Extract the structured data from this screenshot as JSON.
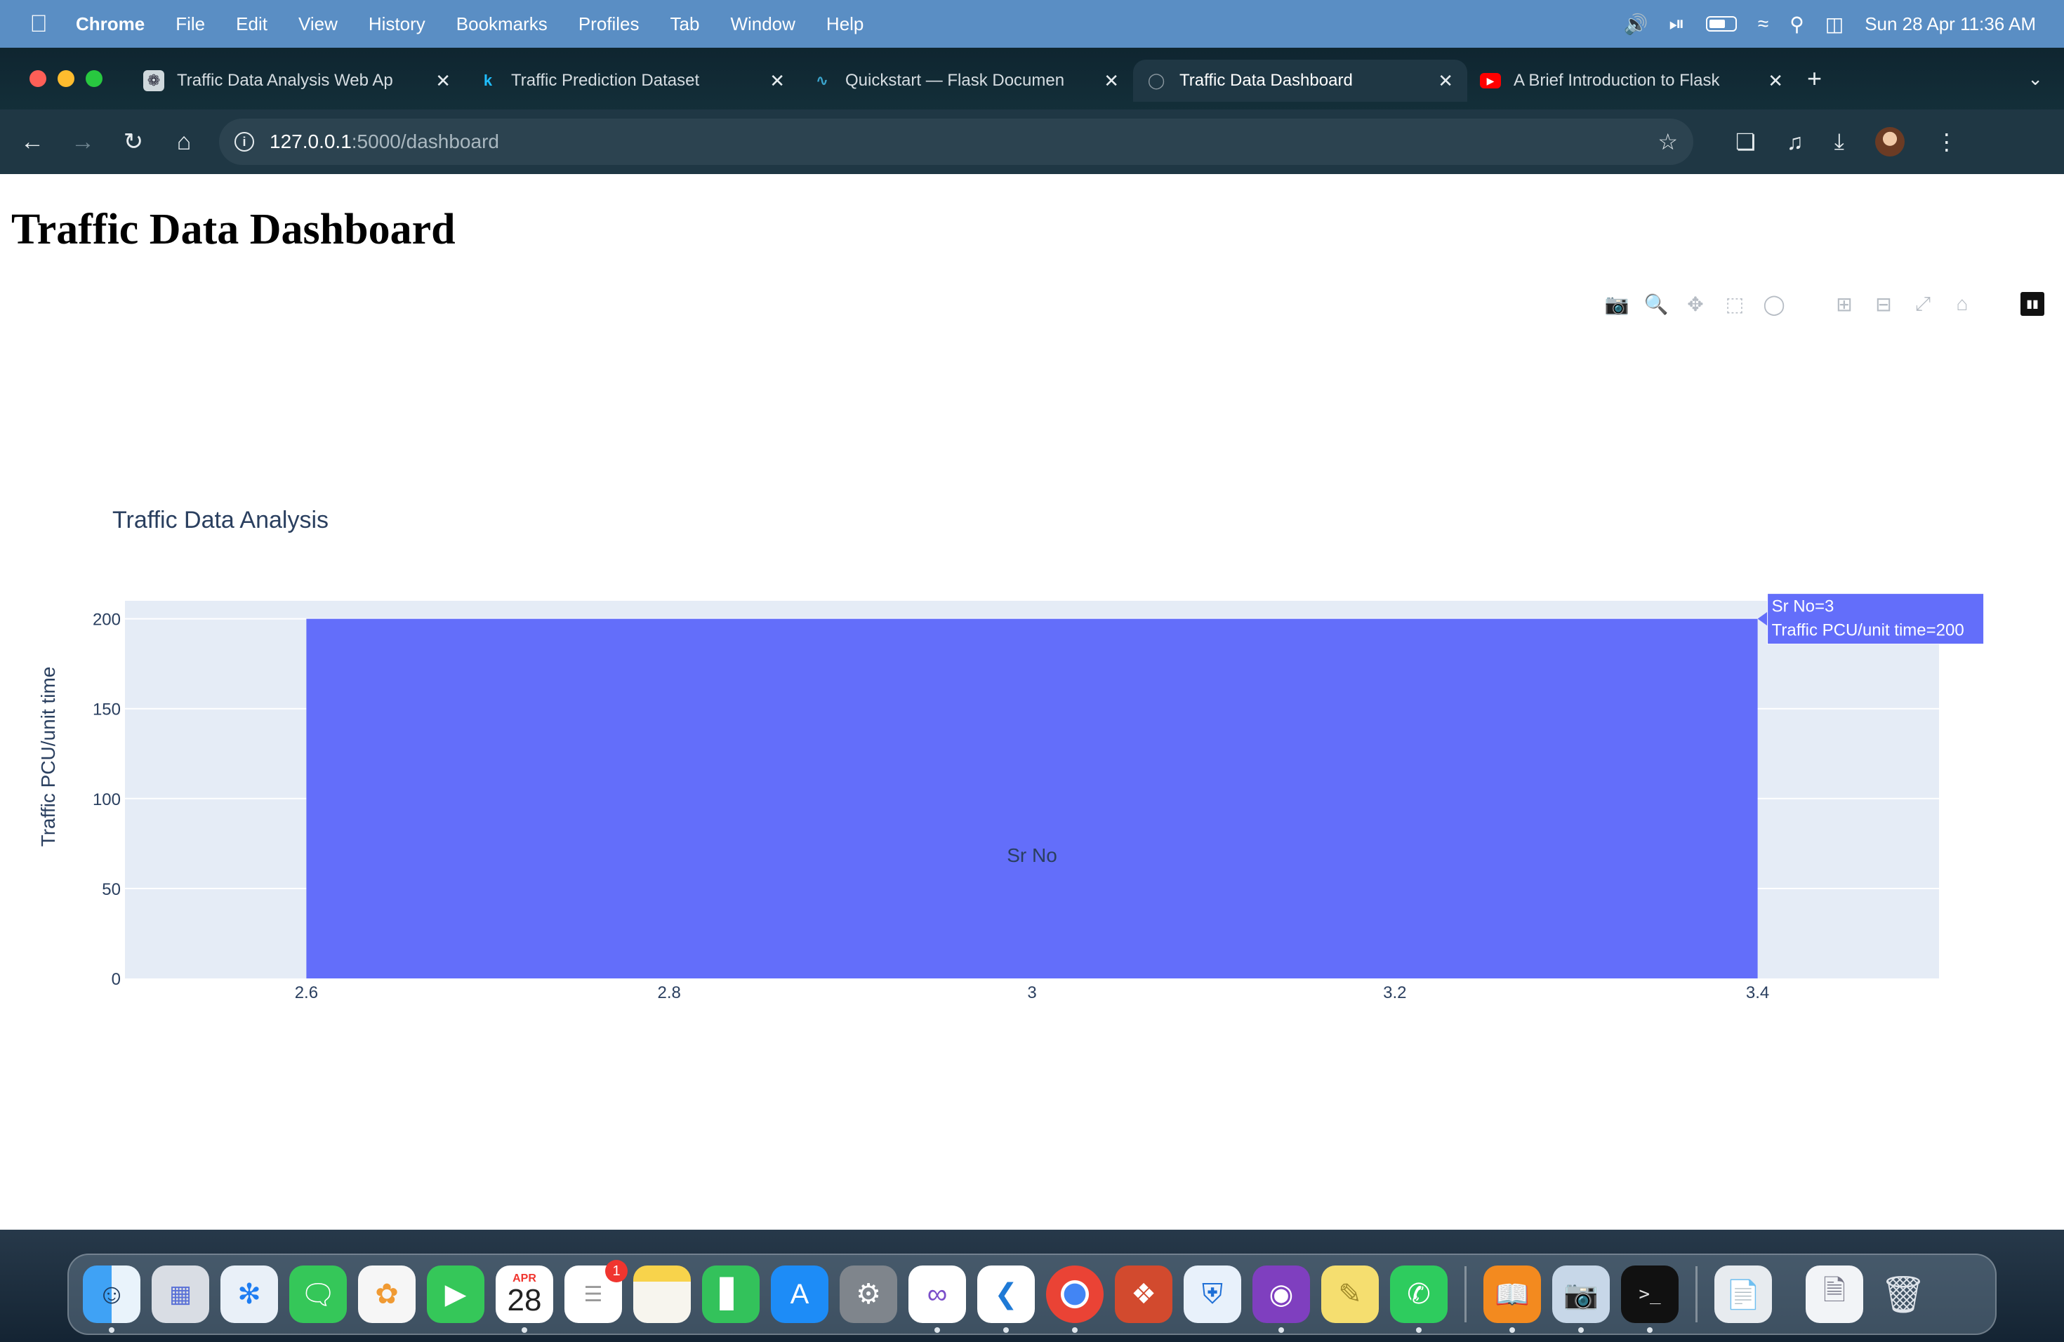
{
  "menubar": {
    "app_name": "Chrome",
    "items": [
      "File",
      "Edit",
      "View",
      "History",
      "Bookmarks",
      "Profiles",
      "Tab",
      "Window",
      "Help"
    ],
    "clock": "Sun 28 Apr  11:36 AM"
  },
  "tabs": [
    {
      "title": "Traffic Data Analysis Web Ap",
      "favicon": "openai-icon",
      "fav_color": "#cfd8dc"
    },
    {
      "title": "Traffic Prediction Dataset",
      "favicon": "kaggle-icon",
      "fav_color": "#20beff"
    },
    {
      "title": "Quickstart — Flask Documen",
      "favicon": "flask-icon",
      "fav_color": "#3ba4cc"
    },
    {
      "title": "Traffic Data Dashboard",
      "favicon": "globe-icon",
      "fav_color": "#8b98a0"
    },
    {
      "title": "A Brief Introduction to Flask",
      "favicon": "youtube-icon",
      "fav_color": "#ff0000"
    }
  ],
  "active_tab": 3,
  "omnibox": {
    "host": "127.0.0.1",
    "path": ":5000/dashboard"
  },
  "page": {
    "title": "Traffic Data Dashboard"
  },
  "chart_data": {
    "type": "bar",
    "title": "Traffic Data Analysis",
    "xlabel": "Sr No",
    "ylabel": "Traffic PCU/unit time",
    "x": [
      3
    ],
    "values": [
      200
    ],
    "bar_width": 0.8,
    "xlim": [
      2.5,
      3.5
    ],
    "ylim": [
      0,
      210
    ],
    "xticks": [
      "2.6",
      "2.8",
      "3",
      "3.2",
      "3.4"
    ],
    "xtick_values": [
      2.6,
      2.8,
      3.0,
      3.2,
      3.4
    ],
    "yticks": [
      "0",
      "50",
      "100",
      "150",
      "200"
    ],
    "ytick_values": [
      0,
      50,
      100,
      150,
      200
    ],
    "bar_color": "#636efa",
    "plot_bg": "#e5ecf6",
    "grid": true,
    "hover": {
      "line1": "Sr No=3",
      "line2": "Traffic PCU/unit time=200"
    }
  },
  "dock": {
    "calendar_month": "APR",
    "calendar_day": "28",
    "reminders_badge": "1",
    "apps": [
      "finder-icon",
      "launchpad-icon",
      "safari-icon",
      "messages-icon",
      "photos-icon",
      "facetime-icon",
      "calendar-icon",
      "reminders-icon",
      "notes-icon",
      "numbers-icon",
      "app-store-icon",
      "system-settings-icon",
      "visual-studio-icon",
      "vscode-icon",
      "chrome-icon",
      "remote-desktop-icon",
      "sql-icon",
      "github-desktop-icon",
      "stickies-icon",
      "whatsapp-icon",
      "books-icon",
      "preview-icon",
      "terminal-icon",
      "documents-folder-icon",
      "downloads-stack-icon",
      "trash-icon"
    ]
  }
}
